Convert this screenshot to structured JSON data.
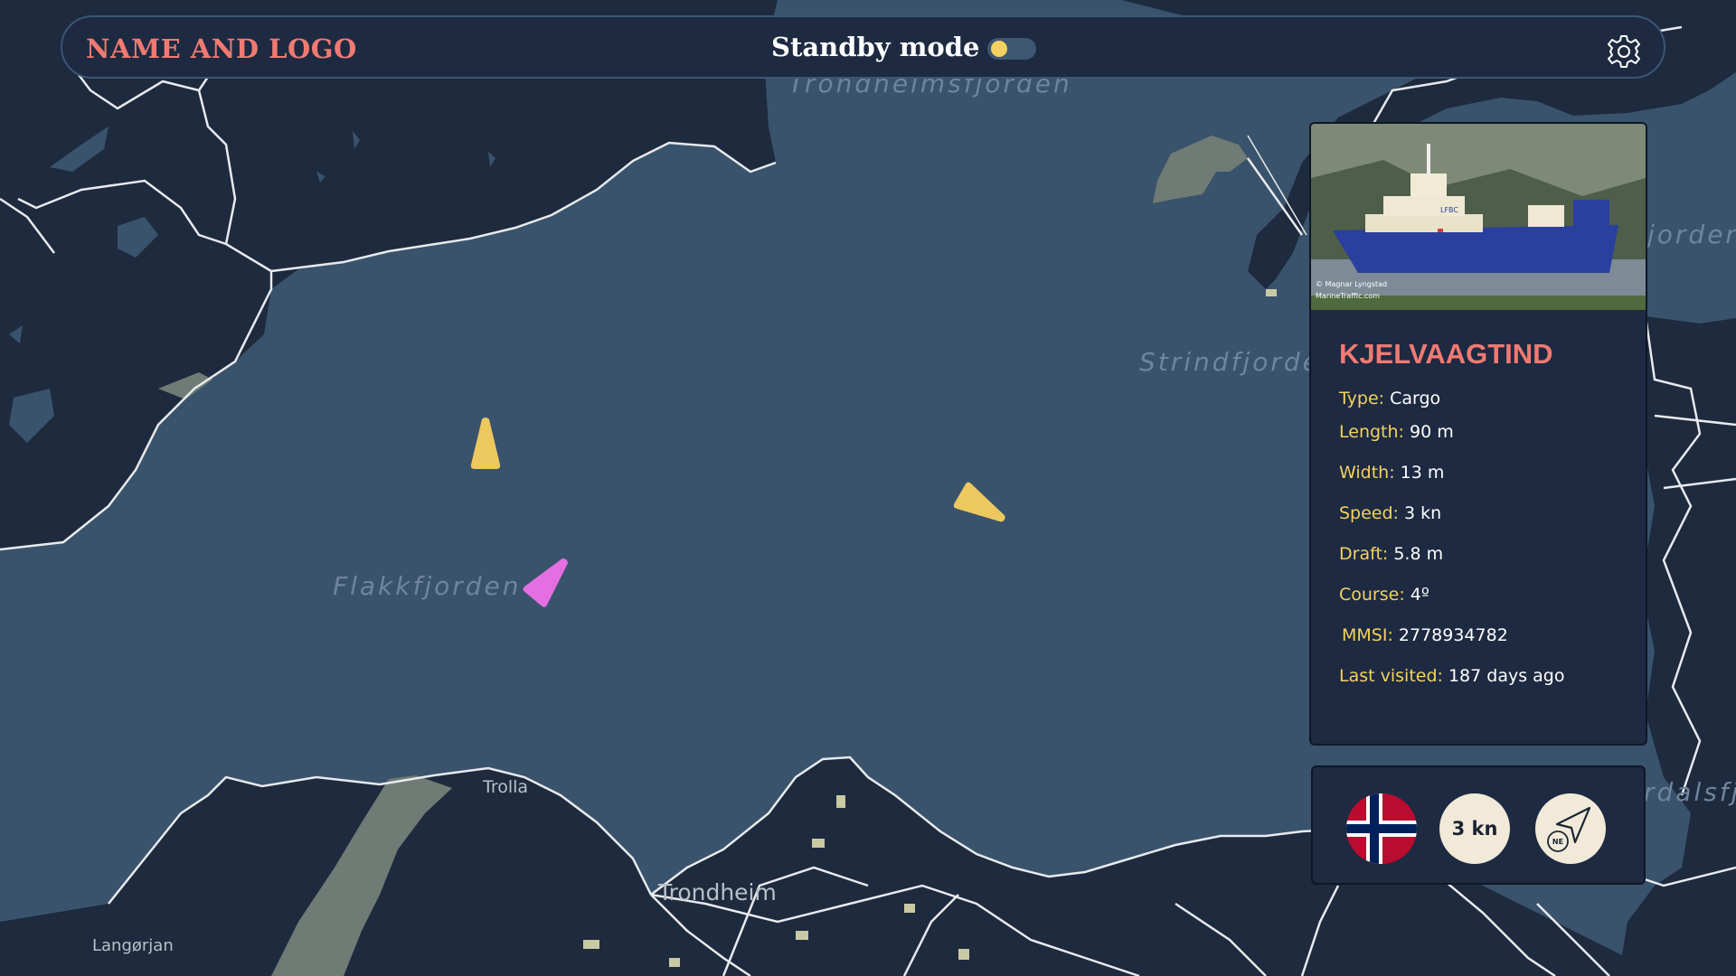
{
  "header": {
    "brand": "NAME AND LOGO",
    "standby_label": "Standby mode",
    "standby_on": false
  },
  "map": {
    "labels": {
      "trondheimsfjorden": "Trondheimsfjorden",
      "strindfjorden": "Strindfjorde",
      "flakkfjorden": "Flakkfjorden",
      "jorden": "jorden",
      "rdalsfj": "rdalsfj",
      "trolla": "Trolla",
      "trondheim": "Trondheim",
      "langorjan": "Langørjan"
    },
    "vessels": [
      {
        "name": "vessel-yellow-north",
        "color": "#edc85e",
        "heading_deg": 0
      },
      {
        "name": "vessel-yellow-east",
        "color": "#edc85e",
        "heading_deg": 120
      },
      {
        "name": "vessel-selected",
        "color": "#e36fe3",
        "heading_deg": 40
      }
    ]
  },
  "vessel": {
    "photo_credit_1": "© Magnar Lyngstad",
    "photo_credit_2": "MarineTraffic.com",
    "hull_mark": "LFBC",
    "name": "KJELVAAGTIND",
    "fields": [
      {
        "label": "Type:",
        "value": " Cargo"
      },
      {
        "label": "Length:",
        "value": " 90 m"
      },
      {
        "label": "Width:",
        "value": " 13 m"
      },
      {
        "label": "Speed:",
        "value": " 3 kn"
      },
      {
        "label": "Draft:",
        "value": " 5.8 m"
      },
      {
        "label": "Course:",
        "value": " 4º"
      },
      {
        "label": "MMSI:",
        "value": " 2778934782"
      },
      {
        "label": "Last visited:",
        "value": " 187 days ago"
      }
    ]
  },
  "indicators": {
    "flag": "norway-flag-icon",
    "speed": "3 kn",
    "course_label": "NE",
    "course_icon": "navigation-arrow-icon"
  },
  "colors": {
    "sea": "#3a536c",
    "land": "#1e2a3e",
    "panel": "#1d2a41",
    "accent_red": "#f07a72",
    "accent_yellow": "#f4d160",
    "selected_vessel": "#e36fe3"
  }
}
